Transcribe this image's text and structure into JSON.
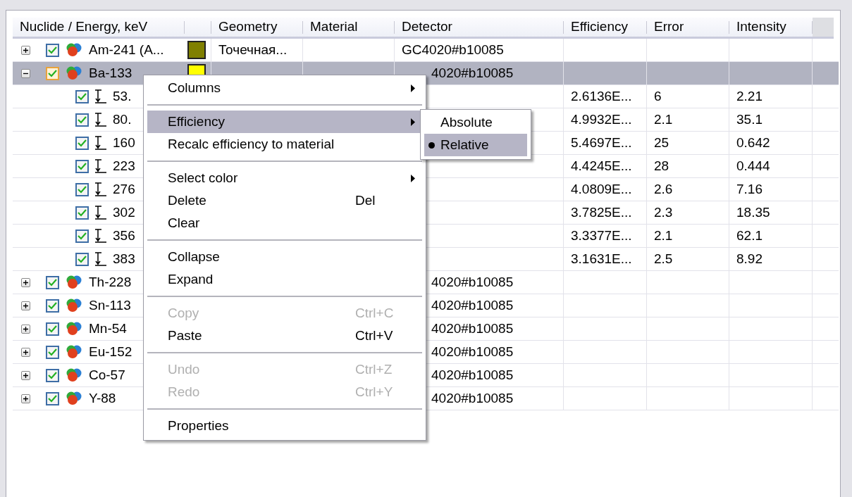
{
  "columns": [
    "Nuclide / Energy, keV",
    "",
    "Geometry",
    "Material",
    "Detector",
    "Efficiency",
    "Error",
    "Intensity"
  ],
  "rows": [
    {
      "name": "Am-241 (A...",
      "checked": true,
      "expanded": false,
      "selected": false,
      "color": "#808000",
      "geometry": "Точечная...",
      "detector": "GC4020#b10085"
    },
    {
      "name": "Ba-133",
      "checked": true,
      "expanded": true,
      "selected": true,
      "color": "#ffff00",
      "detector": "4020#b10085",
      "children": [
        {
          "name": "53.",
          "checked": true,
          "efficiency": "2.6136E...",
          "error": "6",
          "intensity": "2.21"
        },
        {
          "name": "80.",
          "checked": true,
          "efficiency": "4.9932E...",
          "error": "2.1",
          "intensity": "35.1"
        },
        {
          "name": "160",
          "checked": true,
          "efficiency": "5.4697E...",
          "error": "25",
          "intensity": "0.642"
        },
        {
          "name": "223",
          "checked": true,
          "efficiency": "4.4245E...",
          "error": "28",
          "intensity": "0.444"
        },
        {
          "name": "276",
          "checked": true,
          "efficiency": "4.0809E...",
          "error": "2.6",
          "intensity": "7.16"
        },
        {
          "name": "302",
          "checked": true,
          "efficiency": "3.7825E...",
          "error": "2.3",
          "intensity": "18.35"
        },
        {
          "name": "356",
          "checked": true,
          "efficiency": "3.3377E...",
          "error": "2.1",
          "intensity": "62.1"
        },
        {
          "name": "383",
          "checked": true,
          "efficiency": "3.1631E...",
          "error": "2.5",
          "intensity": "8.92"
        }
      ]
    },
    {
      "name": "Th-228",
      "checked": true,
      "expanded": false,
      "selected": false,
      "detector": "4020#b10085"
    },
    {
      "name": "Sn-113",
      "checked": true,
      "expanded": false,
      "selected": false,
      "detector": "4020#b10085"
    },
    {
      "name": "Mn-54",
      "checked": true,
      "expanded": false,
      "selected": false,
      "detector": "4020#b10085"
    },
    {
      "name": "Eu-152",
      "checked": true,
      "expanded": false,
      "selected": false,
      "detector": "4020#b10085"
    },
    {
      "name": "Co-57",
      "checked": true,
      "expanded": false,
      "selected": false,
      "detector": "4020#b10085"
    },
    {
      "name": "Y-88",
      "checked": true,
      "expanded": false,
      "selected": false,
      "detector": "4020#b10085"
    }
  ],
  "context_menu": [
    {
      "kind": "item",
      "label": "Columns",
      "submenu": true,
      "selected": false,
      "disabled": false
    },
    {
      "kind": "separator"
    },
    {
      "kind": "item",
      "label": "Efficiency",
      "submenu": true,
      "selected": true,
      "disabled": false
    },
    {
      "kind": "item",
      "label": "Recalc efficiency to material",
      "submenu": false,
      "selected": false,
      "disabled": false
    },
    {
      "kind": "separator"
    },
    {
      "kind": "item",
      "label": "Select color",
      "submenu": true,
      "selected": false,
      "disabled": false
    },
    {
      "kind": "item",
      "label": "Delete",
      "shortcut": "Del",
      "submenu": false,
      "selected": false,
      "disabled": false
    },
    {
      "kind": "item",
      "label": "Clear",
      "submenu": false,
      "selected": false,
      "disabled": false
    },
    {
      "kind": "separator"
    },
    {
      "kind": "item",
      "label": "Collapse",
      "submenu": false,
      "selected": false,
      "disabled": false
    },
    {
      "kind": "item",
      "label": "Expand",
      "submenu": false,
      "selected": false,
      "disabled": false
    },
    {
      "kind": "separator"
    },
    {
      "kind": "item",
      "label": "Copy",
      "shortcut": "Ctrl+C",
      "submenu": false,
      "selected": false,
      "disabled": true
    },
    {
      "kind": "item",
      "label": "Paste",
      "shortcut": "Ctrl+V",
      "submenu": false,
      "selected": false,
      "disabled": false
    },
    {
      "kind": "separator"
    },
    {
      "kind": "item",
      "label": "Undo",
      "shortcut": "Ctrl+Z",
      "submenu": false,
      "selected": false,
      "disabled": true
    },
    {
      "kind": "item",
      "label": "Redo",
      "shortcut": "Ctrl+Y",
      "submenu": false,
      "selected": false,
      "disabled": true
    },
    {
      "kind": "separator"
    },
    {
      "kind": "item",
      "label": "Properties",
      "submenu": false,
      "selected": false,
      "disabled": false
    }
  ],
  "efficiency_submenu": [
    {
      "label": "Absolute",
      "checked": false,
      "selected": false
    },
    {
      "label": "Relative",
      "checked": true,
      "selected": true
    }
  ]
}
